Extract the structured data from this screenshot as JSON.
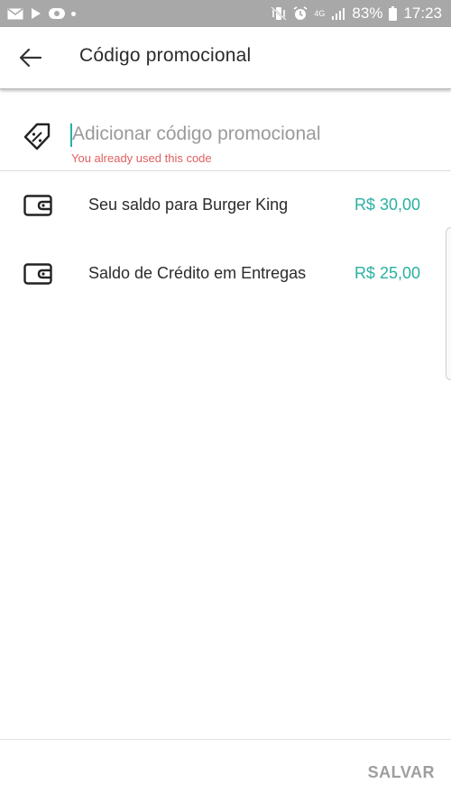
{
  "status_bar": {
    "battery_text": "83%",
    "time": "17:23",
    "network_text": "4G",
    "icons": [
      "mail-icon",
      "play-store-icon",
      "app-notification-icon",
      "dot-icon",
      "mute-vibrate-icon",
      "alarm-icon",
      "signal-icon",
      "battery-icon"
    ]
  },
  "header": {
    "title": "Código promocional",
    "back_icon": "arrow-left-icon"
  },
  "promo": {
    "icon": "promo-tag-icon",
    "placeholder": "Adicionar código promocional",
    "value": "",
    "error": "You already used this code"
  },
  "balances": [
    {
      "icon": "wallet-icon",
      "label": "Seu saldo para Burger King",
      "amount": "R$ 30,00"
    },
    {
      "icon": "wallet-icon",
      "label": "Saldo de Crédito em Entregas",
      "amount": "R$ 25,00"
    }
  ],
  "footer": {
    "save_label": "SALVAR"
  },
  "colors": {
    "accent": "#2bb0a0",
    "error": "#e06060",
    "status_bar": "#a8a8a8",
    "save_disabled": "#9e9e9e"
  }
}
